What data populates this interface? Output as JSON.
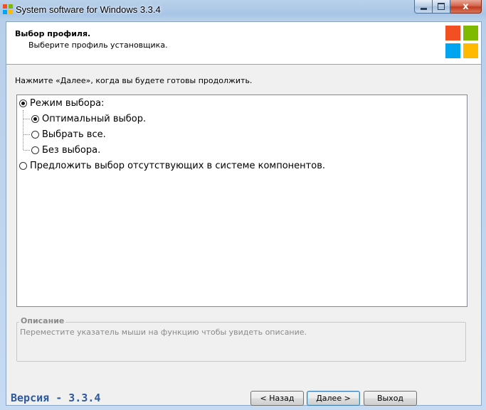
{
  "window": {
    "title": "System software for Windows 3.3.4",
    "close_glyph": "x"
  },
  "header": {
    "title": "Выбор профиля.",
    "subtitle": "Выберите профиль установщика."
  },
  "instruction": "Нажмите «Далее», когда вы будете готовы продолжить.",
  "tree": {
    "items": [
      {
        "label": "Режим выбора:",
        "checked": true,
        "level": 0
      },
      {
        "label": "Оптимальный выбор.",
        "checked": true,
        "level": 1
      },
      {
        "label": "Выбрать все.",
        "checked": false,
        "level": 1
      },
      {
        "label": "Без выбора.",
        "checked": false,
        "level": 1
      },
      {
        "label": "Предложить выбор отсутствующих в системе компонентов.",
        "checked": false,
        "level": 0
      }
    ]
  },
  "description": {
    "legend": "Описание",
    "text": "Переместите указатель мыши на функцию чтобы увидеть описание."
  },
  "footer": {
    "version": "Версия - 3.3.4",
    "back_label": "< Назад",
    "next_label": "Далее >",
    "exit_label": "Выход"
  },
  "colors": {
    "logo_red": "#f25022",
    "logo_green": "#7fba00",
    "logo_blue": "#00a4ef",
    "logo_yellow": "#ffb900",
    "version_blue": "#2e5aa0"
  }
}
